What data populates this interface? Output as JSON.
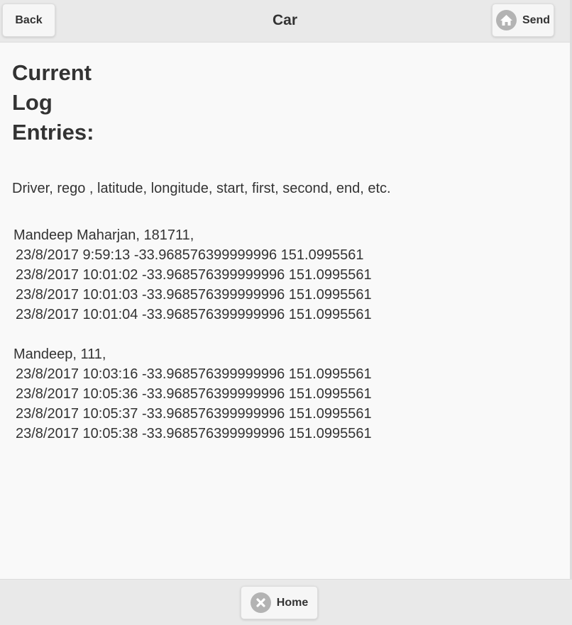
{
  "header": {
    "title": "Car",
    "back_label": "Back",
    "send_label": "Send"
  },
  "main": {
    "heading": "Current Log Entries:",
    "fields_description": "Driver, rego , latitude, longitude, start, first, second, end, etc.",
    "logs": [
      {
        "header": "Mandeep Maharjan, 181711,",
        "entries": [
          "23/8/2017 9:59:13 -33.968576399999996 151.0995561",
          "23/8/2017 10:01:02 -33.968576399999996 151.0995561",
          "23/8/2017 10:01:03 -33.968576399999996 151.0995561",
          "23/8/2017 10:01:04 -33.968576399999996 151.0995561"
        ]
      },
      {
        "header": "Mandeep, 111,",
        "entries": [
          "23/8/2017 10:03:16 -33.968576399999996 151.0995561",
          "23/8/2017 10:05:36 -33.968576399999996 151.0995561",
          "23/8/2017 10:05:37 -33.968576399999996 151.0995561",
          "23/8/2017 10:05:38 -33.968576399999996 151.0995561"
        ]
      }
    ]
  },
  "footer": {
    "home_label": "Home"
  },
  "icons": {
    "send": "home-icon",
    "home": "close-icon"
  },
  "colors": {
    "bar_background": "#e9e9e9",
    "page_background": "#f9f9f9",
    "button_background": "#f6f6f6",
    "icon_background": "#b3b3b3",
    "text": "#333333"
  }
}
